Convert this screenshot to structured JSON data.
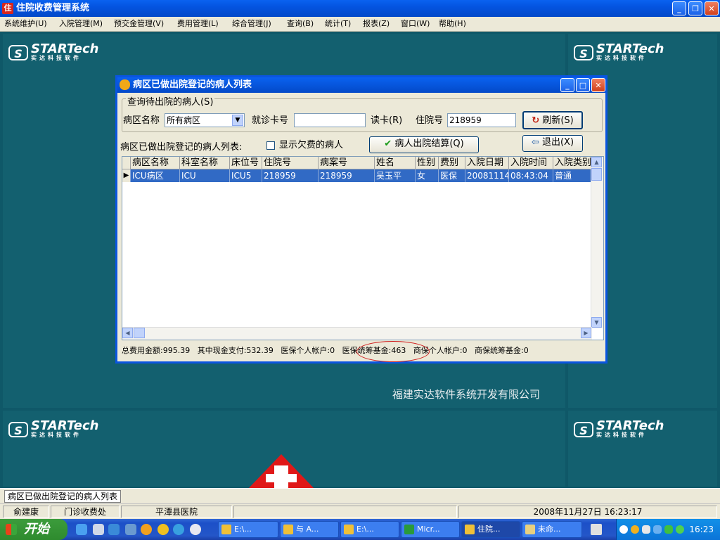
{
  "window": {
    "title": "住院收费管理系统"
  },
  "menu": [
    "系统维护(U)",
    "入院管理(M)",
    "预交金管理(V)",
    "费用管理(L)",
    "综合管理(J)",
    "查询(B)",
    "统计(T)",
    "报表(Z)",
    "窗口(W)",
    "帮助(H)"
  ],
  "logo": {
    "name": "STARTech",
    "sub": "实达科技软件"
  },
  "company": "福建实达软件系统开发有限公司",
  "dialog": {
    "title": "病区已做出院登记的病人列表",
    "group_title": "查询待出院的病人(S)",
    "ward_label": "病区名称",
    "ward_value": "所有病区",
    "card_label": "就诊卡号",
    "card_value": "",
    "read_card_label": "读卡(R)",
    "inpatient_label": "住院号",
    "inpatient_value": "218959",
    "refresh_label": "刷新(S)",
    "list_label": "病区已做出院登记的病人列表:",
    "show_owing_label": "显示欠费的病人",
    "show_owing_checked": false,
    "settle_label": "病人出院结算(Q)",
    "exit_label": "退出(X)",
    "columns": [
      "病区名称",
      "科室名称",
      "床位号",
      "住院号",
      "病案号",
      "姓名",
      "性别",
      "费别",
      "入院日期",
      "入院时间",
      "入院类别"
    ],
    "rows": [
      [
        "ICU病区",
        "ICU",
        "ICU5",
        "218959",
        "218959",
        "吴玉平",
        "女",
        "医保",
        "20081114",
        "08:43:04",
        "普通"
      ]
    ],
    "summary": {
      "total": "总费用金额:995.39",
      "cash": "其中现金支付:532.39",
      "med_personal": "医保个人帐户:0",
      "med_pool": "医保统筹基金:463",
      "biz_personal": "商保个人帐户:0",
      "biz_pool": "商保统筹基金:0"
    }
  },
  "doc_tab": "病区已做出院登记的病人列表",
  "status": {
    "user": "俞建康",
    "dept": "门诊收费处",
    "hospital": "平潭县医院",
    "datetime": "2008年11月27日  16:23:17"
  },
  "taskbar": {
    "start": "开始",
    "buttons": [
      "E:\\...",
      "与 A...",
      "E:\\...",
      "Micr...",
      "住院...",
      "未命..."
    ],
    "active": 4,
    "clock": "16:23"
  },
  "colors": {
    "accent": "#0a55e0",
    "selection": "#316ac5",
    "desktop": "#13606f",
    "highlight_circle": "#d02020"
  }
}
